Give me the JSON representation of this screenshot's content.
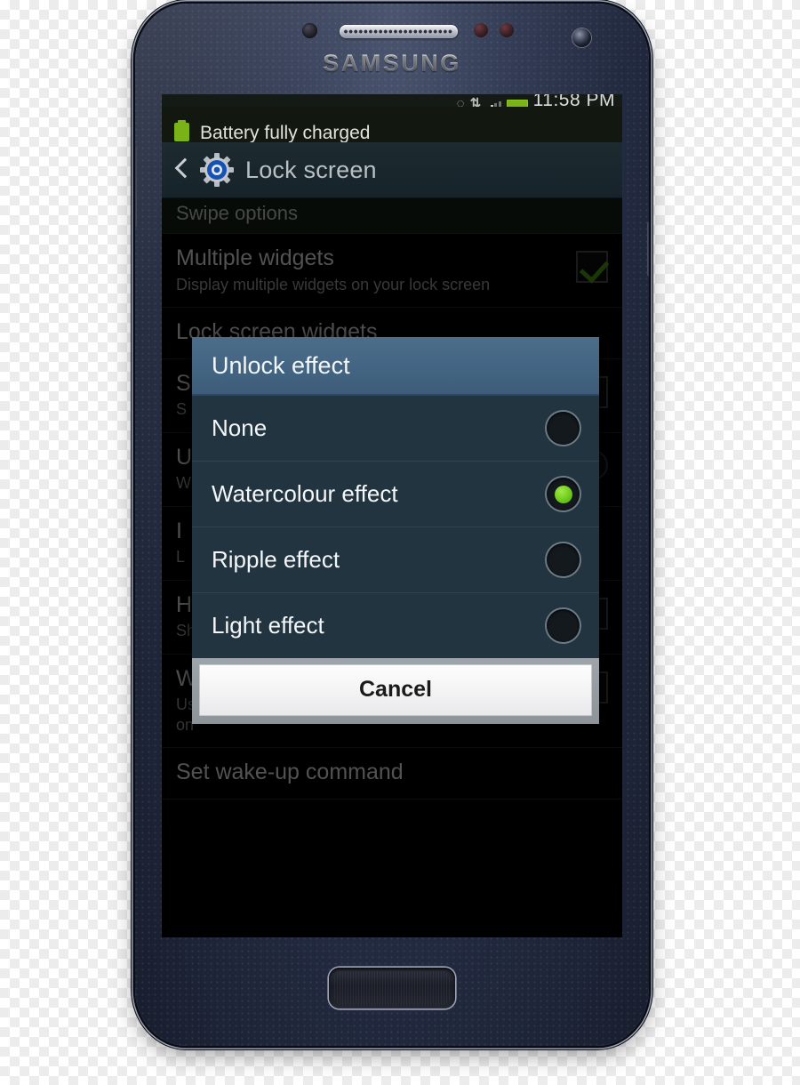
{
  "device": {
    "brand": "SAMSUNG",
    "body_color": "#232b41",
    "accent_green": "#6ecb1c",
    "hardware": {
      "earpiece": "earpiece-speaker",
      "front_camera": "front-camera",
      "proximity_sensor": "proximity-sensor",
      "home_button": "home-button",
      "volume_button": "volume-button",
      "power_button": "power-button"
    }
  },
  "status_bar": {
    "clock": "11:58 PM",
    "icons": [
      "sync-icon",
      "usb-transfer-icon",
      "signal-bars-icon",
      "battery-icon"
    ],
    "sync_glyph": "◌",
    "usb_glyph": "⇅",
    "background": "#141a16"
  },
  "notification": {
    "text": "Battery fully charged",
    "icon": "battery-icon",
    "icon_color": "#7ab317"
  },
  "action_bar": {
    "back_icon": "back-chevron-icon",
    "app_icon": "settings-gear-icon",
    "title": "Lock screen",
    "background": "#17232a"
  },
  "settings": {
    "section_header": "Swipe options",
    "rows": [
      {
        "title": "Multiple widgets",
        "subtitle": "Display multiple widgets on your lock screen",
        "accessory": "checkbox",
        "checked": true
      },
      {
        "title": "Lock screen widgets",
        "subtitle": "",
        "accessory": "none",
        "checked": false
      },
      {
        "title": "S",
        "subtitle": "S",
        "accessory": "checkbox",
        "checked": false
      },
      {
        "title": "U",
        "subtitle": "W",
        "accessory": "circle",
        "checked": false
      },
      {
        "title": "I",
        "subtitle": "L",
        "accessory": "none",
        "checked": false
      },
      {
        "title": "H",
        "subtitle": "Show help text on lock screen",
        "accessory": "checkbox",
        "checked": false
      },
      {
        "title": "Wake up in lock screen",
        "subtitle": "Use wake-up command when swipe unlock is turned on",
        "accessory": "checkbox",
        "checked": false
      },
      {
        "title": "Set wake-up command",
        "subtitle": "",
        "accessory": "none",
        "checked": false
      }
    ]
  },
  "dialog": {
    "title": "Unlock effect",
    "title_background": "#436583",
    "body_background": "#22343f",
    "options": [
      {
        "label": "None",
        "selected": false
      },
      {
        "label": "Watercolour effect",
        "selected": true
      },
      {
        "label": "Ripple effect",
        "selected": false
      },
      {
        "label": "Light effect",
        "selected": false
      }
    ],
    "cancel_label": "Cancel"
  }
}
